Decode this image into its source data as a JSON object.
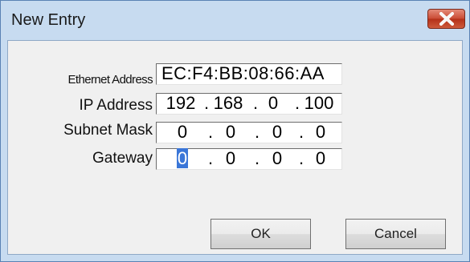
{
  "window": {
    "title": "New Entry"
  },
  "form": {
    "ethernet_label": "Ethernet Address",
    "ethernet_value": "EC:F4:BB:08:66:AA",
    "ip_label": "IP Address",
    "ip_octets": [
      "192",
      "168",
      "0",
      "100"
    ],
    "subnet_label": "Subnet Mask",
    "subnet_octets": [
      "0",
      "0",
      "0",
      "0"
    ],
    "gateway_label": "Gateway",
    "gateway_octets": [
      "0",
      "0",
      "0",
      "0"
    ],
    "separator": "."
  },
  "buttons": {
    "ok_label": "OK",
    "cancel_label": "Cancel"
  },
  "colors": {
    "titlebar": "#c7dbf0",
    "close_button": "#c94a33",
    "selection": "#3a76d8"
  }
}
